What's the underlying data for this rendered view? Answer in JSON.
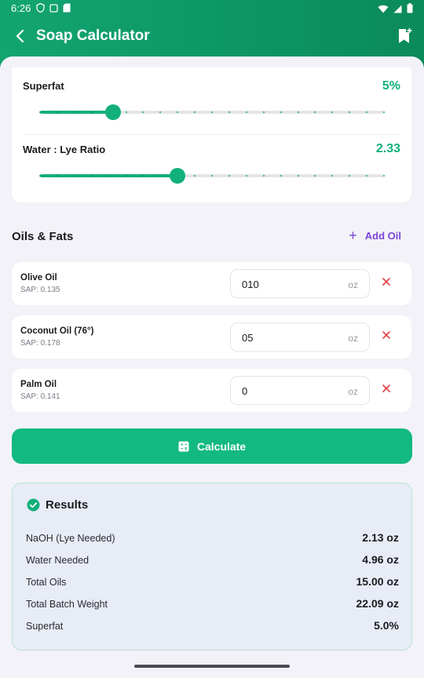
{
  "status": {
    "time": "6:26"
  },
  "appbar": {
    "title": "Soap Calculator"
  },
  "sliders": [
    {
      "label": "Superfat",
      "value": "5%",
      "fraction": 0.213,
      "ticks": 20
    },
    {
      "label": "Water : Lye Ratio",
      "value": "2.33",
      "fraction": 0.4,
      "ticks": 20
    }
  ],
  "oils_section": {
    "title": "Oils & Fats",
    "add_label": "Add Oil"
  },
  "oils": [
    {
      "name": "Olive Oil",
      "sap": "SAP: 0.135",
      "amount": "010",
      "unit": "oz"
    },
    {
      "name": "Coconut Oil (76°)",
      "sap": "SAP: 0.178",
      "amount": "05",
      "unit": "oz"
    },
    {
      "name": "Palm Oil",
      "sap": "SAP: 0.141",
      "amount": "0",
      "unit": "oz"
    }
  ],
  "calculate": {
    "label": "Calculate"
  },
  "results": {
    "title": "Results",
    "rows": [
      {
        "label": "NaOH (Lye Needed)",
        "value": "2.13 oz"
      },
      {
        "label": "Water Needed",
        "value": "4.96 oz"
      },
      {
        "label": "Total Oils",
        "value": "15.00 oz"
      },
      {
        "label": "Total Batch Weight",
        "value": "22.09 oz"
      },
      {
        "label": "Superfat",
        "value": "5.0%"
      }
    ]
  },
  "colors": {
    "accent": "#12b07a",
    "add_oil": "#7a44d8",
    "remove": "#e0454a",
    "header": "#0f9966"
  }
}
